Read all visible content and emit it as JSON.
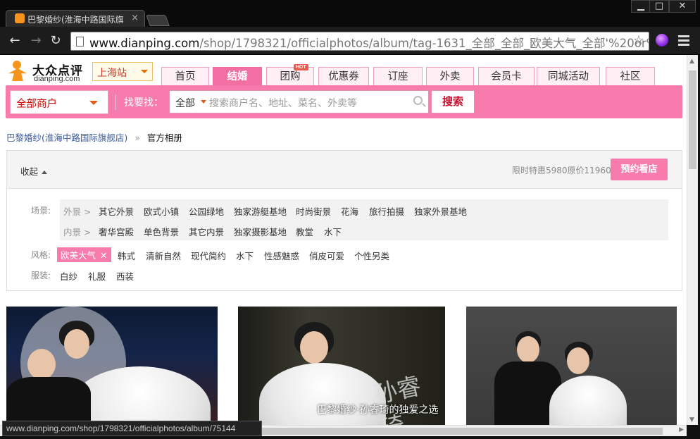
{
  "browser": {
    "tab_title": "巴黎婚纱(淮海中路国际旗",
    "url_domain": "www.dianping.com",
    "url_path": "/shop/1798321/officialphotos/album/tag-1631_全部_全部_欧美大气_全部'%20or%20",
    "status_url": "www.dianping.com/shop/1798321/officialphotos/album/75144"
  },
  "header": {
    "logo_text": "大众点评",
    "logo_sub": "dianping.com",
    "city": "上海站",
    "nav": [
      "首页",
      "结婚",
      "团购",
      "优惠券",
      "订座",
      "外卖",
      "会员卡",
      "同城活动",
      "社区"
    ],
    "hot_badge": "HOT"
  },
  "search": {
    "category": "全部商户",
    "find_label": "找要找：",
    "scope": "全部",
    "placeholder": "搜索商户名、地址、菜名、外卖等",
    "button": "搜索"
  },
  "breadcrumb": {
    "shop": "巴黎婚纱(淮海中路国际旗舰店)",
    "sep": "»",
    "current": "官方相册"
  },
  "filters": {
    "collapse": "收起",
    "promo": "限时特惠5980原价11960",
    "book": "预约看店",
    "scene_label": "场景:",
    "outdoor_label": "外景 >",
    "outdoor": [
      "其它外景",
      "欧式小镇",
      "公园绿地",
      "独家游艇基地",
      "时尚街景",
      "花海",
      "旅行拍摄",
      "独家外景基地"
    ],
    "indoor_label": "内景 >",
    "indoor": [
      "奢华宫殿",
      "单色背景",
      "其它内景",
      "独家摄影基地",
      "教堂",
      "水下"
    ],
    "style_label": "风格:",
    "style_selected": "欧美大气",
    "styles": [
      "韩式",
      "清新自然",
      "现代简约",
      "水下",
      "性感魅惑",
      "俏皮可爱",
      "个性另类"
    ],
    "dress_label": "服装:",
    "dress": [
      "白纱",
      "礼服",
      "西装"
    ]
  },
  "photos": {
    "p2_caption": "巴黎婚纱·孙睿琦的独爱之选",
    "p2_sign": "孙睿琦"
  }
}
